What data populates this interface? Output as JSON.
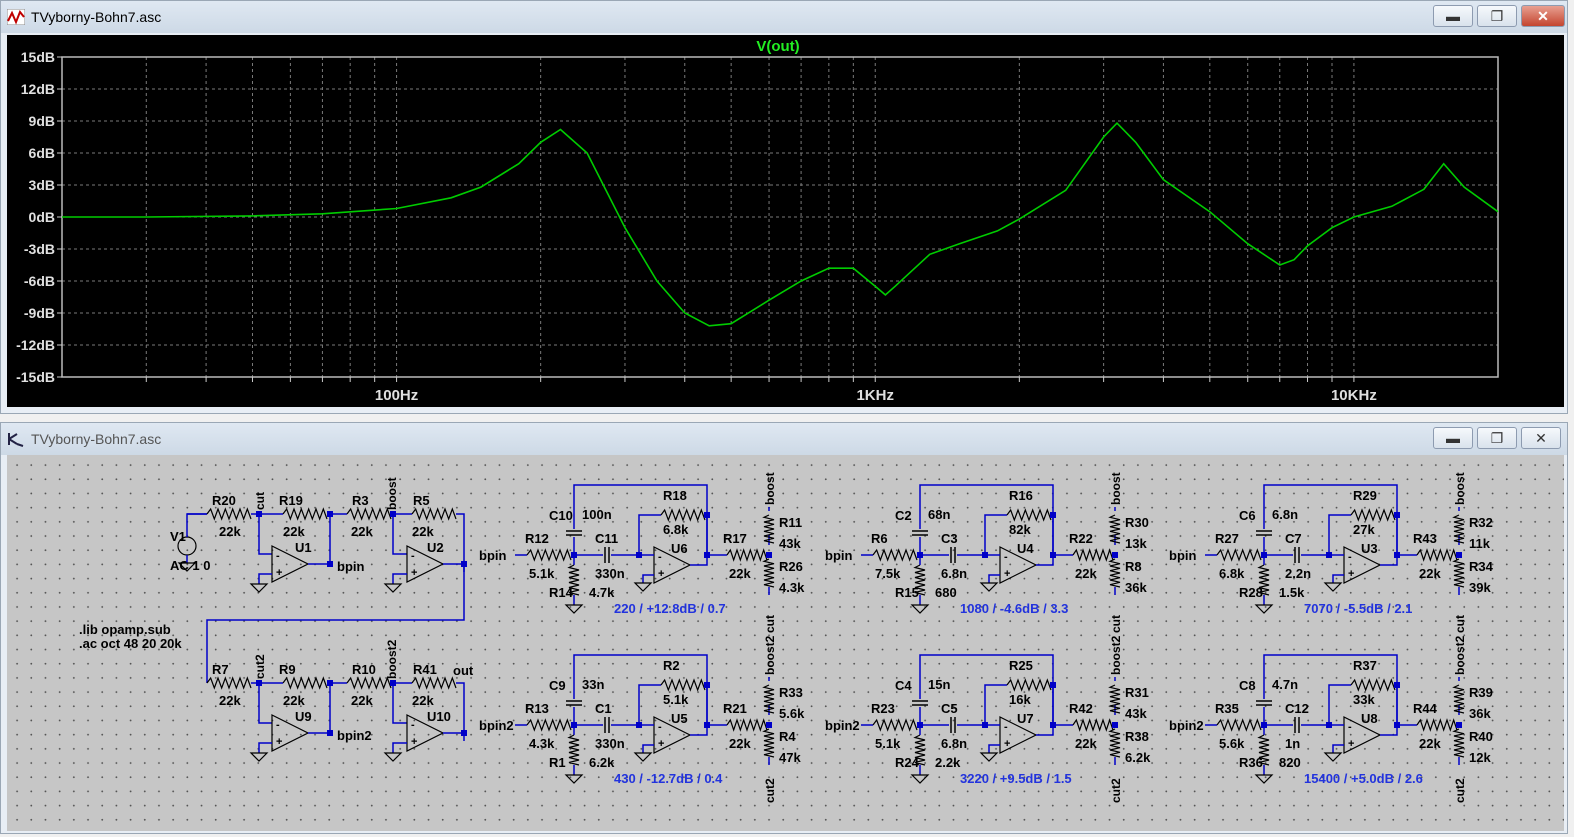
{
  "plot_window": {
    "title": "TVyborny-Bohn7.asc",
    "buttons": {
      "minimize": "▬",
      "maximize": "❐",
      "close": "✕"
    },
    "app_icon": "waveform-icon"
  },
  "schematic_window": {
    "title": "TVyborny-Bohn7.asc",
    "buttons": {
      "minimize": "▬",
      "maximize": "❐",
      "close": "✕"
    },
    "app_icon": "schematic-icon"
  },
  "colors": {
    "plot_bg": "#000000",
    "trace": "#00cc00",
    "grid": "#7a7a7a",
    "axis_text": "#e0e0e0",
    "schematic_bg": "#c6c6c6",
    "wire": "#0000c8",
    "annotation": "#2233dd",
    "component_text": "#000000"
  },
  "chart_data": {
    "type": "line",
    "title": "V(out)",
    "x_scale": "log",
    "xlim": [
      20,
      20000
    ],
    "ylim": [
      -15,
      15
    ],
    "ylabel_ticks": [
      "15dB",
      "12dB",
      "9dB",
      "6dB",
      "3dB",
      "0dB",
      "-3dB",
      "-6dB",
      "-9dB",
      "-12dB",
      "-15dB"
    ],
    "x_ticks": [
      {
        "value": 100,
        "label": "100Hz"
      },
      {
        "value": 1000,
        "label": "1KHz"
      },
      {
        "value": 10000,
        "label": "10KHz"
      }
    ],
    "grid": true,
    "series": [
      {
        "name": "V(out)",
        "x": [
          20,
          30,
          50,
          70,
          100,
          130,
          150,
          180,
          200,
          220,
          250,
          300,
          350,
          400,
          450,
          500,
          600,
          700,
          800,
          900,
          1000,
          1050,
          1100,
          1300,
          1500,
          1800,
          2000,
          2500,
          3000,
          3200,
          3500,
          4000,
          5000,
          6000,
          7000,
          7500,
          8000,
          9000,
          10000,
          12000,
          14000,
          15400,
          17000,
          20000
        ],
        "y": [
          0,
          0,
          0.1,
          0.3,
          0.8,
          1.8,
          2.8,
          5,
          7,
          8.2,
          6,
          -1,
          -6,
          -9,
          -10.2,
          -10,
          -7.8,
          -6,
          -4.8,
          -4.8,
          -6.5,
          -7.3,
          -6.5,
          -3.5,
          -2.5,
          -1.3,
          -0.2,
          2.5,
          7.5,
          8.8,
          7,
          3.5,
          0.5,
          -2.5,
          -4.5,
          -4,
          -2.7,
          -1,
          0,
          1,
          2.6,
          5,
          2.8,
          0.5
        ]
      }
    ]
  },
  "schematic": {
    "directives": [
      ".lib opamp.sub",
      ".ac oct 48 20 20k"
    ],
    "source": {
      "name": "V1",
      "value": "AC 1 0"
    },
    "nets": {
      "cut": "cut",
      "boost": "boost",
      "bpin": "bpin",
      "cut2": "cut2",
      "boost2": "boost2",
      "bpin2": "bpin2",
      "out": "out"
    },
    "input_chain_top": [
      {
        "name": "R20",
        "value": "22k"
      },
      {
        "name": "R19",
        "value": "22k"
      },
      {
        "name": "U1"
      },
      {
        "name": "R3",
        "value": "22k"
      },
      {
        "name": "R5",
        "value": "22k"
      },
      {
        "name": "U2"
      }
    ],
    "input_chain_bottom": [
      {
        "name": "R7",
        "value": "22k"
      },
      {
        "name": "R9",
        "value": "22k"
      },
      {
        "name": "U9"
      },
      {
        "name": "R10",
        "value": "22k"
      },
      {
        "name": "R41",
        "value": "22k"
      },
      {
        "name": "U10"
      }
    ],
    "filters": [
      {
        "net_in": "bpin",
        "rin": "R12",
        "rin_v": "5.1k",
        "rgnd": "R14",
        "rgnd_v": "4.7k",
        "cs": "C10",
        "cs_v": "100n",
        "cser": "C11",
        "cser_v": "330n",
        "rfb": "R18",
        "rfb_v": "6.8k",
        "amp": "U6",
        "rout": "R17",
        "rout_v": "22k",
        "pot_a": "R11",
        "pot_a_v": "43k",
        "pot_b": "R26",
        "pot_b_v": "4.3k",
        "top_net": "boost",
        "bot_net": "cut",
        "note": "220 / +12.8dB / 0.7"
      },
      {
        "net_in": "bpin",
        "rin": "R6",
        "rin_v": "7.5k",
        "rgnd": "R15",
        "rgnd_v": "680",
        "cs": "C2",
        "cs_v": "68n",
        "cser": "C3",
        "cser_v": "6.8n",
        "rfb": "R16",
        "rfb_v": "82k",
        "amp": "U4",
        "rout": "R22",
        "rout_v": "22k",
        "pot_a": "R30",
        "pot_a_v": "13k",
        "pot_b": "R8",
        "pot_b_v": "36k",
        "top_net": "boost",
        "bot_net": "cut",
        "note": "1080 / -4.6dB / 3.3"
      },
      {
        "net_in": "bpin",
        "rin": "R27",
        "rin_v": "6.8k",
        "rgnd": "R28",
        "rgnd_v": "1.5k",
        "cs": "C6",
        "cs_v": "6.8n",
        "cser": "C7",
        "cser_v": "2.2n",
        "rfb": "R29",
        "rfb_v": "27k",
        "amp": "U3",
        "rout": "R43",
        "rout_v": "22k",
        "pot_a": "R32",
        "pot_a_v": "11k",
        "pot_b": "R34",
        "pot_b_v": "39k",
        "top_net": "boost",
        "bot_net": "cut",
        "note": "7070 / -5.5dB / 2.1"
      },
      {
        "net_in": "bpin2",
        "rin": "R13",
        "rin_v": "4.3k",
        "rgnd": "R1",
        "rgnd_v": "6.2k",
        "cs": "C9",
        "cs_v": "33n",
        "cser": "C1",
        "cser_v": "330n",
        "rfb": "R2",
        "rfb_v": "5.1k",
        "amp": "U5",
        "rout": "R21",
        "rout_v": "22k",
        "pot_a": "R33",
        "pot_a_v": "5.6k",
        "pot_b": "R4",
        "pot_b_v": "47k",
        "top_net": "boost2",
        "bot_net": "cut2",
        "note": "430 / -12.7dB / 0.4"
      },
      {
        "net_in": "bpin2",
        "rin": "R23",
        "rin_v": "5.1k",
        "rgnd": "R24",
        "rgnd_v": "2.2k",
        "cs": "C4",
        "cs_v": "15n",
        "cser": "C5",
        "cser_v": "6.8n",
        "rfb": "R25",
        "rfb_v": "16k",
        "amp": "U7",
        "rout": "R42",
        "rout_v": "22k",
        "pot_a": "R31",
        "pot_a_v": "43k",
        "pot_b": "R38",
        "pot_b_v": "6.2k",
        "top_net": "boost2",
        "bot_net": "cut2",
        "note": "3220 / +9.5dB / 1.5"
      },
      {
        "net_in": "bpin2",
        "rin": "R35",
        "rin_v": "5.6k",
        "rgnd": "R36",
        "rgnd_v": "820",
        "cs": "C8",
        "cs_v": "4.7n",
        "cser": "C12",
        "cser_v": "1n",
        "rfb": "R37",
        "rfb_v": "33k",
        "amp": "U8",
        "rout": "R44",
        "rout_v": "22k",
        "pot_a": "R39",
        "pot_a_v": "36k",
        "pot_b": "R40",
        "pot_b_v": "12k",
        "top_net": "boost2",
        "bot_net": "cut2",
        "note": "15400 / +5.0dB / 2.6"
      }
    ]
  }
}
